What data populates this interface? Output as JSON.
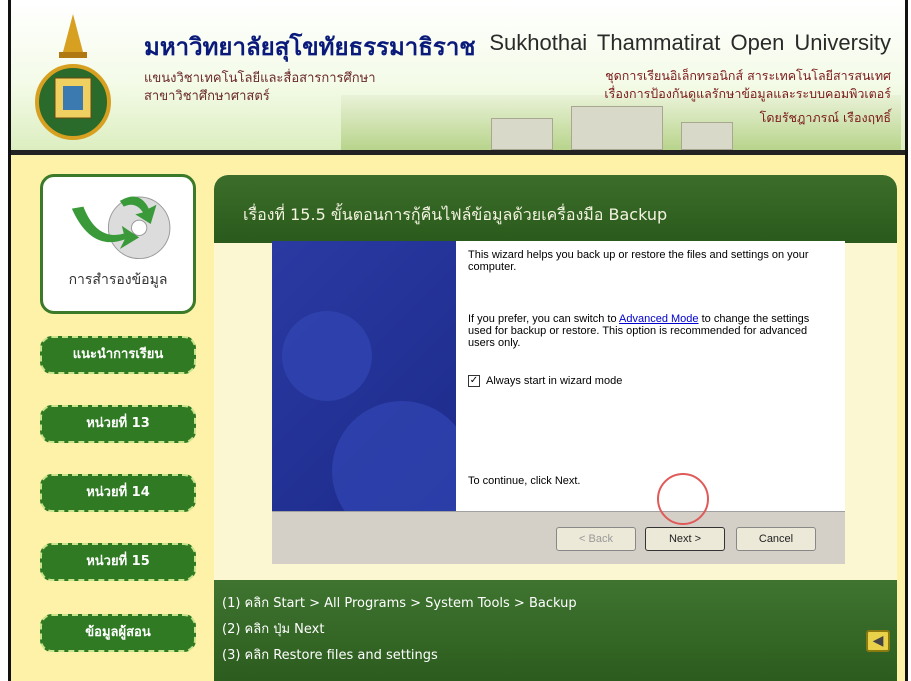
{
  "header": {
    "university_th": "มหาวิทยาลัยสุโขทัยธรรมาธิราช",
    "department_line1": "แขนงวิชาเทคโนโลยีและสื่อสารการศึกษา",
    "department_line2": "สาขาวิชาศึกษาศาสตร์",
    "university_en": "Sukhothai Thammatirat Open University",
    "set_line1": "ชุดการเรียนอิเล็กทรอนิกส์ สาระเทคโนโลยีสารสนเทศ",
    "set_line2": "เรื่องการป้องกันดูแลรักษาข้อมูลและระบบคอมพิวเตอร์",
    "author": "โดยรัชฎาภรณ์ เรืองฤทธิ์"
  },
  "sidebar": {
    "card_label": "การสำรองข้อมูล",
    "items": [
      {
        "label": "แนะนำการเรียน"
      },
      {
        "label": "หน่วยที่ 13"
      },
      {
        "label": "หน่วยที่ 14"
      },
      {
        "label": "หน่วยที่ 15"
      },
      {
        "label": "ข้อมูลผู้สอน"
      }
    ]
  },
  "content": {
    "title": "เรื่องที่ 15.5 ขั้นตอนการกู้คืนไฟล์ข้อมูลด้วยเครื่องมือ Backup",
    "steps": [
      "(1) คลิก Start > All Programs > System Tools > Backup",
      "(2) คลิก ปุ่ม Next",
      "(3) คลิก Restore files and settings"
    ]
  },
  "wizard": {
    "intro": "This wizard helps you back up or restore the files and settings on your computer.",
    "advanced_pre": "If you prefer, you can switch to ",
    "advanced_link": "Advanced Mode",
    "advanced_post": " to change the settings used for backup or restore. This option is recommended for advanced users only.",
    "checkbox_label": "Always start in wizard mode",
    "continue_text": "To continue, click Next.",
    "back_label": "< Back",
    "next_label": "Next >",
    "cancel_label": "Cancel"
  }
}
